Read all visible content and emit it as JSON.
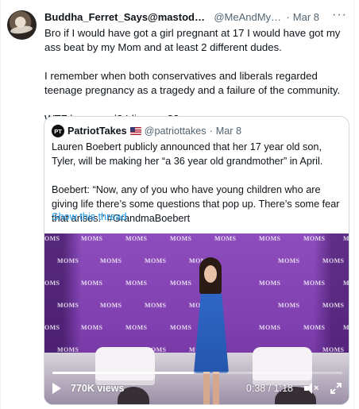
{
  "tweet": {
    "display_name": "Buddha_Ferret_Says@mastodon.world...",
    "handle": "@MeAndMyFerr...",
    "separator": "·",
    "timestamp": "Mar 8",
    "more_icon": "more-horizontal-icon",
    "text": "Bro if I would have got a girl pregnant at 17 I would have got my ass beat by my Mom and at least 2 different dudes.\n\nI remember when both conservatives and liberals regarded teenage pregnancy as a tragedy and a failure of the community.\n\nWTF happened? Idiocracy??"
  },
  "quote": {
    "avatar_text": "PT",
    "display_name": "PatriotTakes",
    "flag_icon": "us-flag-icon",
    "handle": "@patriottakes",
    "separator": "·",
    "timestamp": "Mar 8",
    "text": "Lauren Boebert publicly announced that her 17 year old son, Tyler, will be making her “a 36 year old grandmother” in April.\n\nBoebert: “Now, any of you who have young children who are giving life there’s some questions that pop up. There’s some fear that arises.” #GrandmaBoebert",
    "show_thread": "Show this thread"
  },
  "video": {
    "banner_word": "MOMS",
    "views": "770K views",
    "time": "0:38 / 1:18",
    "progress": 0.487,
    "icons": [
      "play-icon",
      "volume-muted-icon",
      "fullscreen-icon"
    ]
  },
  "colors": {
    "text_primary": "#0f1419",
    "text_secondary": "#536471",
    "link": "#1d9bf0",
    "border": "#cfd9de",
    "backdrop_purple": "#7f3faf",
    "dress_blue": "#2f66c7"
  }
}
